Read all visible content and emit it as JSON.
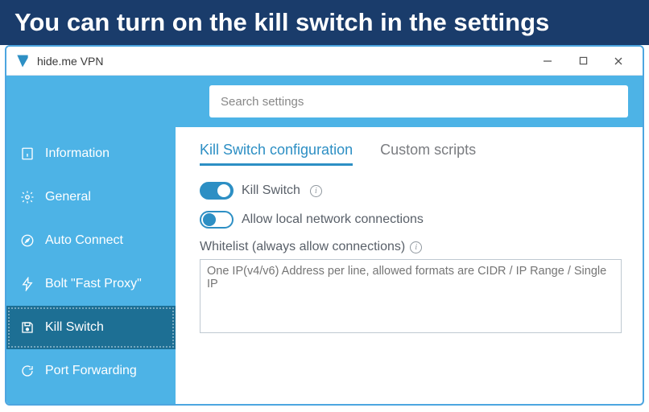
{
  "banner": {
    "text": "You can turn on the kill switch in the settings"
  },
  "window": {
    "title": "hide.me VPN"
  },
  "search": {
    "placeholder": "Search settings"
  },
  "sidebar": {
    "items": [
      {
        "label": "Information"
      },
      {
        "label": "General"
      },
      {
        "label": "Auto Connect"
      },
      {
        "label": "Bolt \"Fast Proxy\""
      },
      {
        "label": "Kill Switch"
      },
      {
        "label": "Port Forwarding"
      }
    ],
    "active_index": 4
  },
  "tabs": {
    "items": [
      {
        "label": "Kill Switch configuration"
      },
      {
        "label": "Custom scripts"
      }
    ],
    "active_index": 0
  },
  "toggles": {
    "kill_switch_label": "Kill Switch",
    "allow_local_label": "Allow local network connections",
    "kill_switch_on": true,
    "allow_local_on": false
  },
  "whitelist": {
    "label": "Whitelist (always allow connections)",
    "placeholder": "One IP(v4/v6) Address per line, allowed formats are CIDR / IP Range / Single IP"
  }
}
